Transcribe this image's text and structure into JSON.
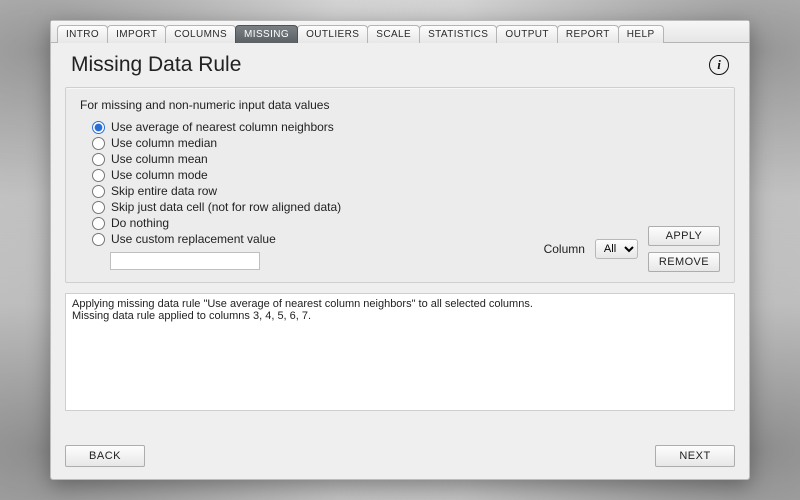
{
  "tabs": [
    {
      "label": "INTRO",
      "active": false
    },
    {
      "label": "IMPORT",
      "active": false
    },
    {
      "label": "COLUMNS",
      "active": false
    },
    {
      "label": "MISSING",
      "active": true
    },
    {
      "label": "OUTLIERS",
      "active": false
    },
    {
      "label": "SCALE",
      "active": false
    },
    {
      "label": "STATISTICS",
      "active": false
    },
    {
      "label": "OUTPUT",
      "active": false
    },
    {
      "label": "REPORT",
      "active": false
    },
    {
      "label": "HELP",
      "active": false
    }
  ],
  "title": "Missing Data Rule",
  "info_glyph": "i",
  "panel": {
    "subtitle": "For missing and non-numeric input data values",
    "options": [
      {
        "label": "Use average of nearest column neighbors",
        "selected": true
      },
      {
        "label": "Use column median",
        "selected": false
      },
      {
        "label": "Use column mean",
        "selected": false
      },
      {
        "label": "Use column mode",
        "selected": false
      },
      {
        "label": "Skip entire data row",
        "selected": false
      },
      {
        "label": "Skip just data cell (not for row aligned data)",
        "selected": false
      },
      {
        "label": "Do nothing",
        "selected": false
      },
      {
        "label": "Use custom replacement value",
        "selected": false
      }
    ],
    "custom_value": "",
    "column_label": "Column",
    "column_options": [
      "All"
    ],
    "column_selected": "All",
    "apply_label": "APPLY",
    "remove_label": "REMOVE"
  },
  "log": "Applying missing data rule \"Use average of nearest column neighbors\" to all selected columns.\nMissing data rule applied to columns 3, 4, 5, 6, 7.",
  "footer": {
    "back_label": "BACK",
    "next_label": "NEXT"
  }
}
